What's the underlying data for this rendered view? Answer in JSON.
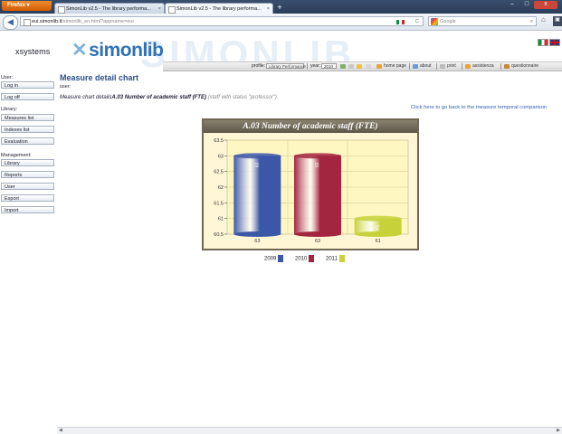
{
  "browser": {
    "menu_label": "Firefox ▾",
    "tabs": [
      {
        "label": "SimonLib v2.5 - The library performa..."
      },
      {
        "label": "SimonLib v2.5 - The library performa..."
      }
    ],
    "tab_close": "×",
    "new_tab": "+",
    "url_host": "eui.simonlib.it",
    "url_path": "/simonlib_en.html?appname=eui",
    "search_placeholder": "Google",
    "window_controls": {
      "min": "–",
      "max": "□",
      "close": "x"
    }
  },
  "header": {
    "company": "xsystems",
    "logo": "simonlib",
    "watermark": "SIMONLIB"
  },
  "toolbar": {
    "profile_label": "profile:",
    "profile_value": "Library Performance",
    "year_label": "year:",
    "year_value": "2010",
    "home_link": "home page",
    "about_link": "about",
    "print_link": "print",
    "assistance_link": "assistenza",
    "questionnaire_link": "questionnaire"
  },
  "sidebar": {
    "user_label": "User:",
    "login": "Log in",
    "logoff": "Log off",
    "library_label": "Library:",
    "measures": "Measures list",
    "indexes": "Indexes list",
    "evaluation": "Evaluation",
    "management_label": "Management:",
    "library": "Library",
    "reports": "Reports",
    "user": "User",
    "export": "Export",
    "import": "Import"
  },
  "main": {
    "title": "Measure detail chart",
    "user_line": "user:",
    "desc_prefix": "Measure chart details",
    "desc_measure": "A.03 Number of academic staff (FTE)",
    "desc_status": "(staff with status \"professor\").",
    "back_link": "Click here to go back to the measure temporal comparison"
  },
  "chart_data": {
    "type": "bar",
    "title": "A.03 Number of academic staff (FTE)",
    "categories": [
      "63",
      "63",
      "61"
    ],
    "series": [
      {
        "name": "2009",
        "value": 63,
        "label": "63",
        "color": "#3d57a8"
      },
      {
        "name": "2010",
        "value": 63,
        "label": "63",
        "color": "#a3253f"
      },
      {
        "name": "2011",
        "value": 61,
        "label": "61",
        "color": "#c7d23a"
      }
    ],
    "ylim": [
      60.5,
      63.5
    ],
    "yticks": [
      "63.5",
      "63",
      "62.5",
      "62",
      "61.5",
      "61",
      "60.5"
    ],
    "grid": true,
    "legend_position": "bottom"
  }
}
